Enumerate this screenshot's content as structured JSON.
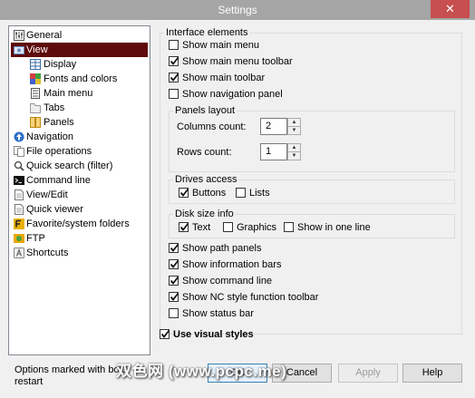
{
  "window": {
    "title": "Settings",
    "close_glyph": "✕"
  },
  "tree": {
    "items": [
      {
        "label": "General",
        "icon": "sliders-icon",
        "color": "#555555"
      },
      {
        "label": "View",
        "icon": "view-icon",
        "color": "#6a8ac0",
        "selected": true
      },
      {
        "label": "Display",
        "icon": "grid-icon",
        "color": "#3a6ea5"
      },
      {
        "label": "Fonts and colors",
        "icon": "colors-icon",
        "color": "#d04040"
      },
      {
        "label": "Main menu",
        "icon": "menu-icon",
        "color": "#555555"
      },
      {
        "label": "Tabs",
        "icon": "tabs-icon",
        "color": "#999999"
      },
      {
        "label": "Panels",
        "icon": "panels-icon",
        "color": "#e0a020"
      },
      {
        "label": "Navigation",
        "icon": "arrow-up-icon",
        "color": "#2c6fc6"
      },
      {
        "label": "File operations",
        "icon": "file-ops-icon",
        "color": "#888888"
      },
      {
        "label": "Quick search (filter)",
        "icon": "magnifier-icon",
        "color": "#444444"
      },
      {
        "label": "Command line",
        "icon": "terminal-icon",
        "color": "#111111"
      },
      {
        "label": "View/Edit",
        "icon": "document-icon",
        "color": "#777777"
      },
      {
        "label": "Quick viewer",
        "icon": "document-icon",
        "color": "#777777"
      },
      {
        "label": "Favorite/system folders",
        "icon": "favorite-folder-icon",
        "color": "#e8b000"
      },
      {
        "label": "FTP",
        "icon": "ftp-icon",
        "color": "#e8a800"
      },
      {
        "label": "Shortcuts",
        "icon": "shortcut-icon",
        "color": "#888888"
      }
    ]
  },
  "interface": {
    "legend": "Interface elements",
    "show_main_menu": {
      "label": "Show main menu",
      "checked": false
    },
    "show_main_menu_toolbar": {
      "label": "Show main menu toolbar",
      "checked": true
    },
    "show_main_toolbar": {
      "label": "Show main toolbar",
      "checked": true
    },
    "show_navigation_panel": {
      "label": "Show navigation panel",
      "checked": false
    },
    "panels_layout": {
      "legend": "Panels layout",
      "columns_label": "Columns count:",
      "columns_value": "2",
      "rows_label": "Rows count:",
      "rows_value": "1"
    },
    "drives_access": {
      "legend": "Drives access",
      "buttons": {
        "label": "Buttons",
        "checked": true
      },
      "lists": {
        "label": "Lists",
        "checked": false
      }
    },
    "disk_size_info": {
      "legend": "Disk size info",
      "text": {
        "label": "Text",
        "checked": true
      },
      "graphics": {
        "label": "Graphics",
        "checked": false
      },
      "one_line": {
        "label": "Show in one line",
        "checked": false
      }
    },
    "show_path_panels": {
      "label": "Show path panels",
      "checked": true
    },
    "show_information_bars": {
      "label": "Show information bars",
      "checked": true
    },
    "show_command_line": {
      "label": "Show command line",
      "checked": true
    },
    "show_nc_toolbar": {
      "label": "Show NC style function toolbar",
      "checked": true
    },
    "show_status_bar": {
      "label": "Show status bar",
      "checked": false
    }
  },
  "use_visual_styles": {
    "label": "Use visual styles",
    "checked": true
  },
  "footer": {
    "note_line1": "Options marked with bold",
    "note_line2": "restart",
    "ok_label": "OK",
    "cancel_label": "Cancel",
    "apply_label": "Apply",
    "help_label": "Help"
  },
  "watermark": "双色网 (www.pcpc.me)"
}
